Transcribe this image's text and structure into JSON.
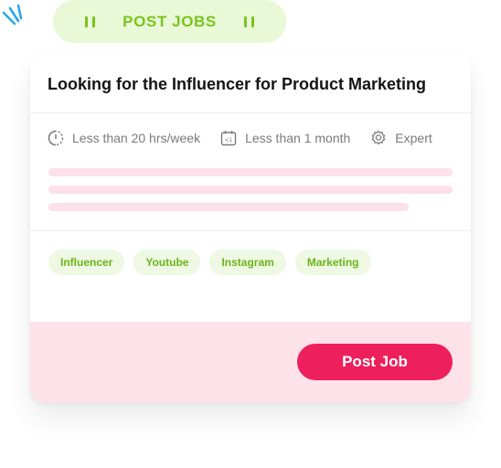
{
  "header": {
    "label": "POST JOBS",
    "accent_color": "#7ac41e",
    "background_color": "#e9f8d6",
    "left_icon": "pause-icon",
    "right_icon": "pause-icon"
  },
  "decoration": {
    "icon": "sparkle-lines-icon",
    "color": "#2aa8e8"
  },
  "job": {
    "title": "Looking for the Influencer for Product Marketing",
    "meta": [
      {
        "icon": "half-circle-clock-icon",
        "text": "Less than 20 hrs/week"
      },
      {
        "icon": "calendar-icon",
        "text": "Less than 1 month"
      },
      {
        "icon": "gear-icon",
        "text": "Expert"
      }
    ],
    "tags": [
      "Influencer",
      "Youtube",
      "Instagram",
      "Marketing"
    ]
  },
  "footer": {
    "button_label": "Post Job",
    "button_color": "#ed1f5c",
    "background_color": "#fde2ea"
  }
}
